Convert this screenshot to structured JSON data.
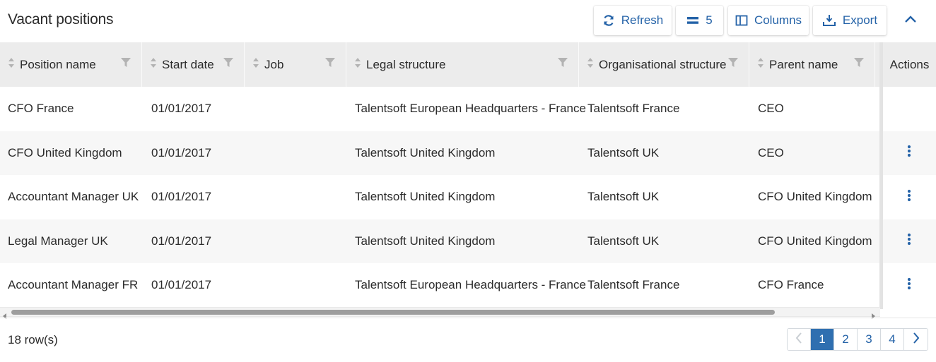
{
  "title": "Vacant positions",
  "toolbar": {
    "refresh_label": "Refresh",
    "rows_label": "5",
    "columns_label": "Columns",
    "export_label": "Export"
  },
  "columns": [
    {
      "label": "Position name",
      "sortable": true,
      "filter": true
    },
    {
      "label": "Start date",
      "sortable": true,
      "filter": true
    },
    {
      "label": "Job",
      "sortable": true,
      "filter": true
    },
    {
      "label": "Legal structure",
      "sortable": true,
      "filter": true
    },
    {
      "label": "Organisational structure",
      "sortable": true,
      "filter": true
    },
    {
      "label": "Parent name",
      "sortable": true,
      "filter": true
    },
    {
      "label": "Actions",
      "sortable": false,
      "filter": false
    }
  ],
  "rows": [
    {
      "position": "CFO France",
      "start": "01/01/2017",
      "job": "",
      "legal": "Talentsoft European Headquarters - France",
      "org": "Talentsoft France",
      "parent": "CEO",
      "actions": false
    },
    {
      "position": "CFO United Kingdom",
      "start": "01/01/2017",
      "job": "",
      "legal": "Talentsoft United Kingdom",
      "org": "Talentsoft UK",
      "parent": "CEO",
      "actions": true
    },
    {
      "position": "Accountant Manager UK",
      "start": "01/01/2017",
      "job": "",
      "legal": "Talentsoft United Kingdom",
      "org": "Talentsoft UK",
      "parent": "CFO United Kingdom",
      "actions": true
    },
    {
      "position": "Legal Manager UK",
      "start": "01/01/2017",
      "job": "",
      "legal": "Talentsoft United Kingdom",
      "org": "Talentsoft UK",
      "parent": "CFO United Kingdom",
      "actions": true
    },
    {
      "position": "Accountant Manager FR",
      "start": "01/01/2017",
      "job": "",
      "legal": "Talentsoft European Headquarters - France",
      "org": "Talentsoft France",
      "parent": "CFO France",
      "actions": true
    }
  ],
  "footer": {
    "row_count": "18 row(s)",
    "pages": [
      "1",
      "2",
      "3",
      "4"
    ],
    "current_page": "1"
  },
  "colors": {
    "accent": "#2563a8",
    "header_bg": "#ececec",
    "active_page": "#2f6fb0"
  },
  "icons": {
    "refresh": "refresh-icon",
    "rows": "rows-icon",
    "columns": "columns-icon",
    "export": "export-icon",
    "collapse": "chevron-up-icon",
    "sort": "sort-icon",
    "filter": "filter-icon",
    "kebab": "kebab-icon"
  }
}
